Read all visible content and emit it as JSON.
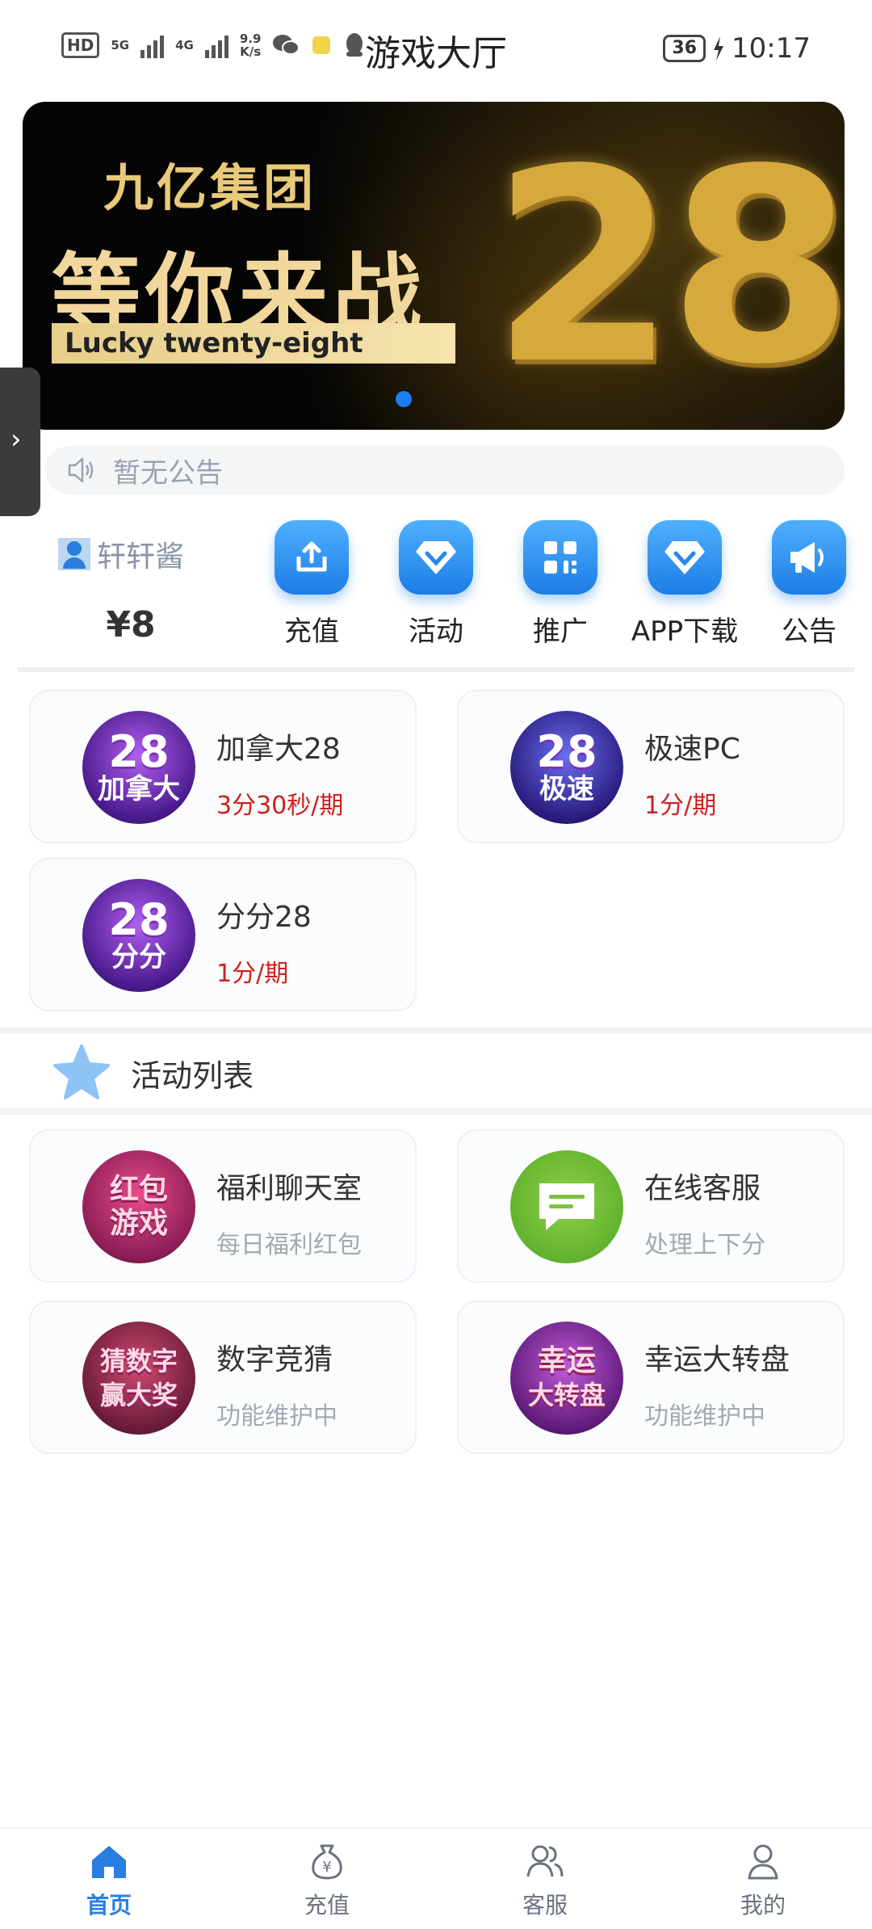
{
  "status_bar": {
    "hd": "HD",
    "net_5g": "5G",
    "net_4g": "4G",
    "speed_value": "9.9",
    "speed_unit": "K/s",
    "title": "游戏大厅",
    "battery": "36",
    "time": "10:17"
  },
  "banner": {
    "line1": "九亿集团",
    "line2": "等你来战",
    "tag": "Lucky twenty-eight",
    "number": "28"
  },
  "notice": {
    "text": "暂无公告"
  },
  "user": {
    "name": "轩轩酱",
    "balance": "¥8"
  },
  "quick_actions": [
    {
      "label": "充值",
      "icon": "upload-icon"
    },
    {
      "label": "活动",
      "icon": "diamond-icon"
    },
    {
      "label": "推广",
      "icon": "qr-icon"
    },
    {
      "label": "APP下载",
      "icon": "diamond-icon"
    },
    {
      "label": "公告",
      "icon": "megaphone-icon"
    }
  ],
  "games": [
    {
      "title": "加拿大28",
      "subtitle": "3分30秒/期",
      "badge_top": "28",
      "badge_bottom": "加拿大"
    },
    {
      "title": "极速PC",
      "subtitle": "1分/期",
      "badge_top": "28",
      "badge_bottom": "极速"
    },
    {
      "title": "分分28",
      "subtitle": "1分/期",
      "badge_top": "28",
      "badge_bottom": "分分"
    }
  ],
  "activity_section": {
    "title": "活动列表"
  },
  "activities": [
    {
      "title": "福利聊天室",
      "subtitle": "每日福利红包",
      "badge_top": "红包",
      "badge_bottom": "游戏"
    },
    {
      "title": "在线客服",
      "subtitle": "处理上下分",
      "icon": "chat-icon"
    },
    {
      "title": "数字竞猜",
      "subtitle": "功能维护中",
      "badge_top": "猜数字",
      "badge_bottom": "赢大奖"
    },
    {
      "title": "幸运大转盘",
      "subtitle": "功能维护中",
      "badge_top": "幸运",
      "badge_bottom": "大转盘"
    }
  ],
  "bottom_nav": [
    {
      "label": "首页",
      "icon": "home-icon",
      "active": true
    },
    {
      "label": "充值",
      "icon": "money-bag-icon",
      "active": false
    },
    {
      "label": "客服",
      "icon": "users-icon",
      "active": false
    },
    {
      "label": "我的",
      "icon": "person-icon",
      "active": false
    }
  ],
  "colors": {
    "accent": "#2a7de1",
    "red_text": "#d0201e",
    "grey_text": "#a3a9b3"
  }
}
